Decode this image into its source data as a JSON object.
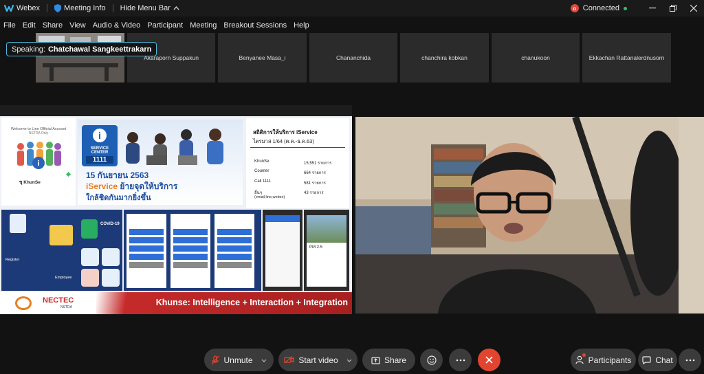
{
  "titlebar": {
    "app_name": "Webex",
    "meeting_info": "Meeting Info",
    "hide_menu": "Hide Menu Bar",
    "status": "Connected"
  },
  "menu": [
    "File",
    "Edit",
    "Share",
    "View",
    "Audio & Video",
    "Participant",
    "Meeting",
    "Breakout Sessions",
    "Help"
  ],
  "speaking": {
    "prefix": "Speaking:",
    "name": "Chatchawal Sangkeettrakarn"
  },
  "participants": [
    "Akaraporn Suppakun",
    "Benyanee Masa_i",
    "Chananchida",
    "chanchira kobkan",
    "chanukoon",
    "Ekkachan Rattanalerdnusorn"
  ],
  "slide": {
    "welcome": "Welcome to Line Official Account",
    "welcome2": "NSTDA Only",
    "khunse": "ขุ KhunSe",
    "service_center": "SERVICE CENTER",
    "center_num": "1111",
    "date_line": "15 กันยายน 2563",
    "iservice": "iService",
    "move_line": "ย้ายจุดให้บริการ",
    "closer_line": "ใกล้ชิดกันมากยิ่งขึ้น",
    "stats_title": "สถิติการให้บริการ iService",
    "stats_subtitle": "ไตรมาส 1/64 (ต.ค.-ธ.ค.63)",
    "stats": [
      {
        "label": "KhunSe",
        "value": "15,551 รายการ"
      },
      {
        "label": "Counter",
        "value": "664 รายการ"
      },
      {
        "label": "Call 1111",
        "value": "581 รายการ"
      },
      {
        "label": "อื่นๆ",
        "value": "43 รายการ"
      }
    ],
    "stats_note": "(email,line,webex)",
    "brand": "NECTEC",
    "brand_sub": "NSTDA",
    "tagline": "Khunse: Intelligence + Interaction + Integration",
    "covid": "COVID-19",
    "register": "Register",
    "employee": "Employee",
    "pm_label": "PM 2.5"
  },
  "toolbar": {
    "unmute": "Unmute",
    "start_video": "Start video",
    "share": "Share",
    "participants": "Participants",
    "chat": "Chat"
  },
  "colors": {
    "accent": "#4fb7d8",
    "end": "#e2452f",
    "slide_navy": "#1d3a78",
    "slide_red": "#c52a2a"
  }
}
